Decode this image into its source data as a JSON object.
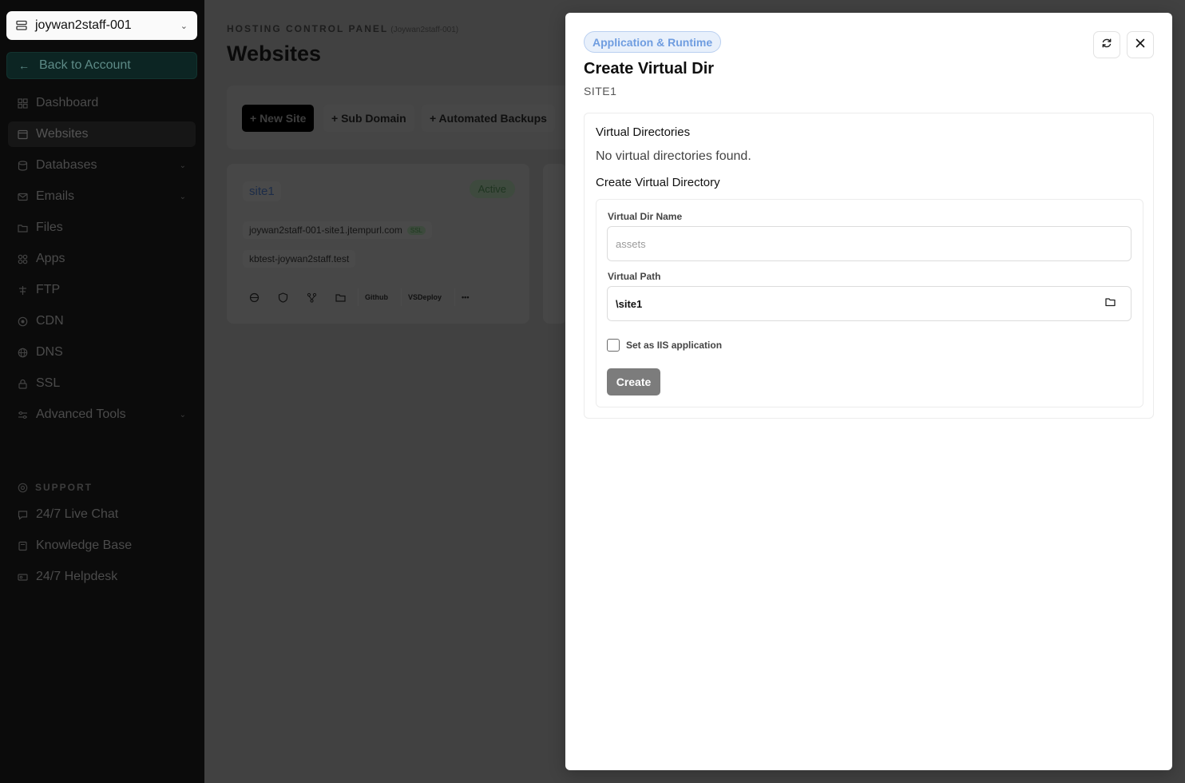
{
  "sidebar": {
    "account": {
      "name": "joywan2staff-001"
    },
    "back_label": "Back to Account",
    "items": [
      {
        "label": "Dashboard",
        "icon": "grid-icon"
      },
      {
        "label": "Websites",
        "icon": "browser-icon",
        "active": true
      },
      {
        "label": "Databases",
        "icon": "database-icon",
        "expandable": true
      },
      {
        "label": "Emails",
        "icon": "mail-icon",
        "expandable": true
      },
      {
        "label": "Files",
        "icon": "folder-icon"
      },
      {
        "label": "Apps",
        "icon": "apps-icon"
      },
      {
        "label": "FTP",
        "icon": "ftp-icon"
      },
      {
        "label": "CDN",
        "icon": "cdn-icon"
      },
      {
        "label": "DNS",
        "icon": "globe-icon"
      },
      {
        "label": "SSL",
        "icon": "lock-icon"
      },
      {
        "label": "Advanced Tools",
        "icon": "sliders-icon",
        "expandable": true
      }
    ],
    "support": {
      "title": "SUPPORT",
      "items": [
        {
          "label": "24/7 Live Chat",
          "icon": "chat-icon"
        },
        {
          "label": "Knowledge Base",
          "icon": "book-icon"
        },
        {
          "label": "24/7 Helpdesk",
          "icon": "ticket-icon"
        }
      ]
    }
  },
  "main": {
    "eyebrow": "HOSTING CONTROL PANEL",
    "eyebrow_sub": "(Joywan2staff-001)",
    "title": "Websites",
    "toolbar": {
      "new_site": "+ New Site",
      "sub_domain": "+ Sub Domain",
      "automated_backups": "+ Automated Backups"
    },
    "site_card": {
      "name": "site1",
      "status": "Active",
      "domains": [
        {
          "host": "joywan2staff-001-site1.jtempurl.com",
          "ssl": "SSL"
        },
        {
          "host": "kbtest-joywan2staff.test"
        }
      ],
      "actions": {
        "github": "Github",
        "vsdeploy": "VSDeploy",
        "more": "•••"
      }
    }
  },
  "modal": {
    "category": "Application & Runtime",
    "title": "Create Virtual Dir",
    "subtitle": "SITE1",
    "list_heading": "Virtual Directories",
    "empty_text": "No virtual directories found.",
    "form_heading": "Create Virtual Directory",
    "name_label": "Virtual Dir Name",
    "name_value": "",
    "name_placeholder": "assets",
    "path_label": "Virtual Path",
    "path_value": "\\site1",
    "iis_label": "Set as IIS application",
    "iis_checked": false,
    "submit_label": "Create"
  },
  "colors": {
    "accent_badge_text": "#6f9de0",
    "accent_badge_bg": "#e8f0fb",
    "create_button": "#7c7c7c"
  }
}
